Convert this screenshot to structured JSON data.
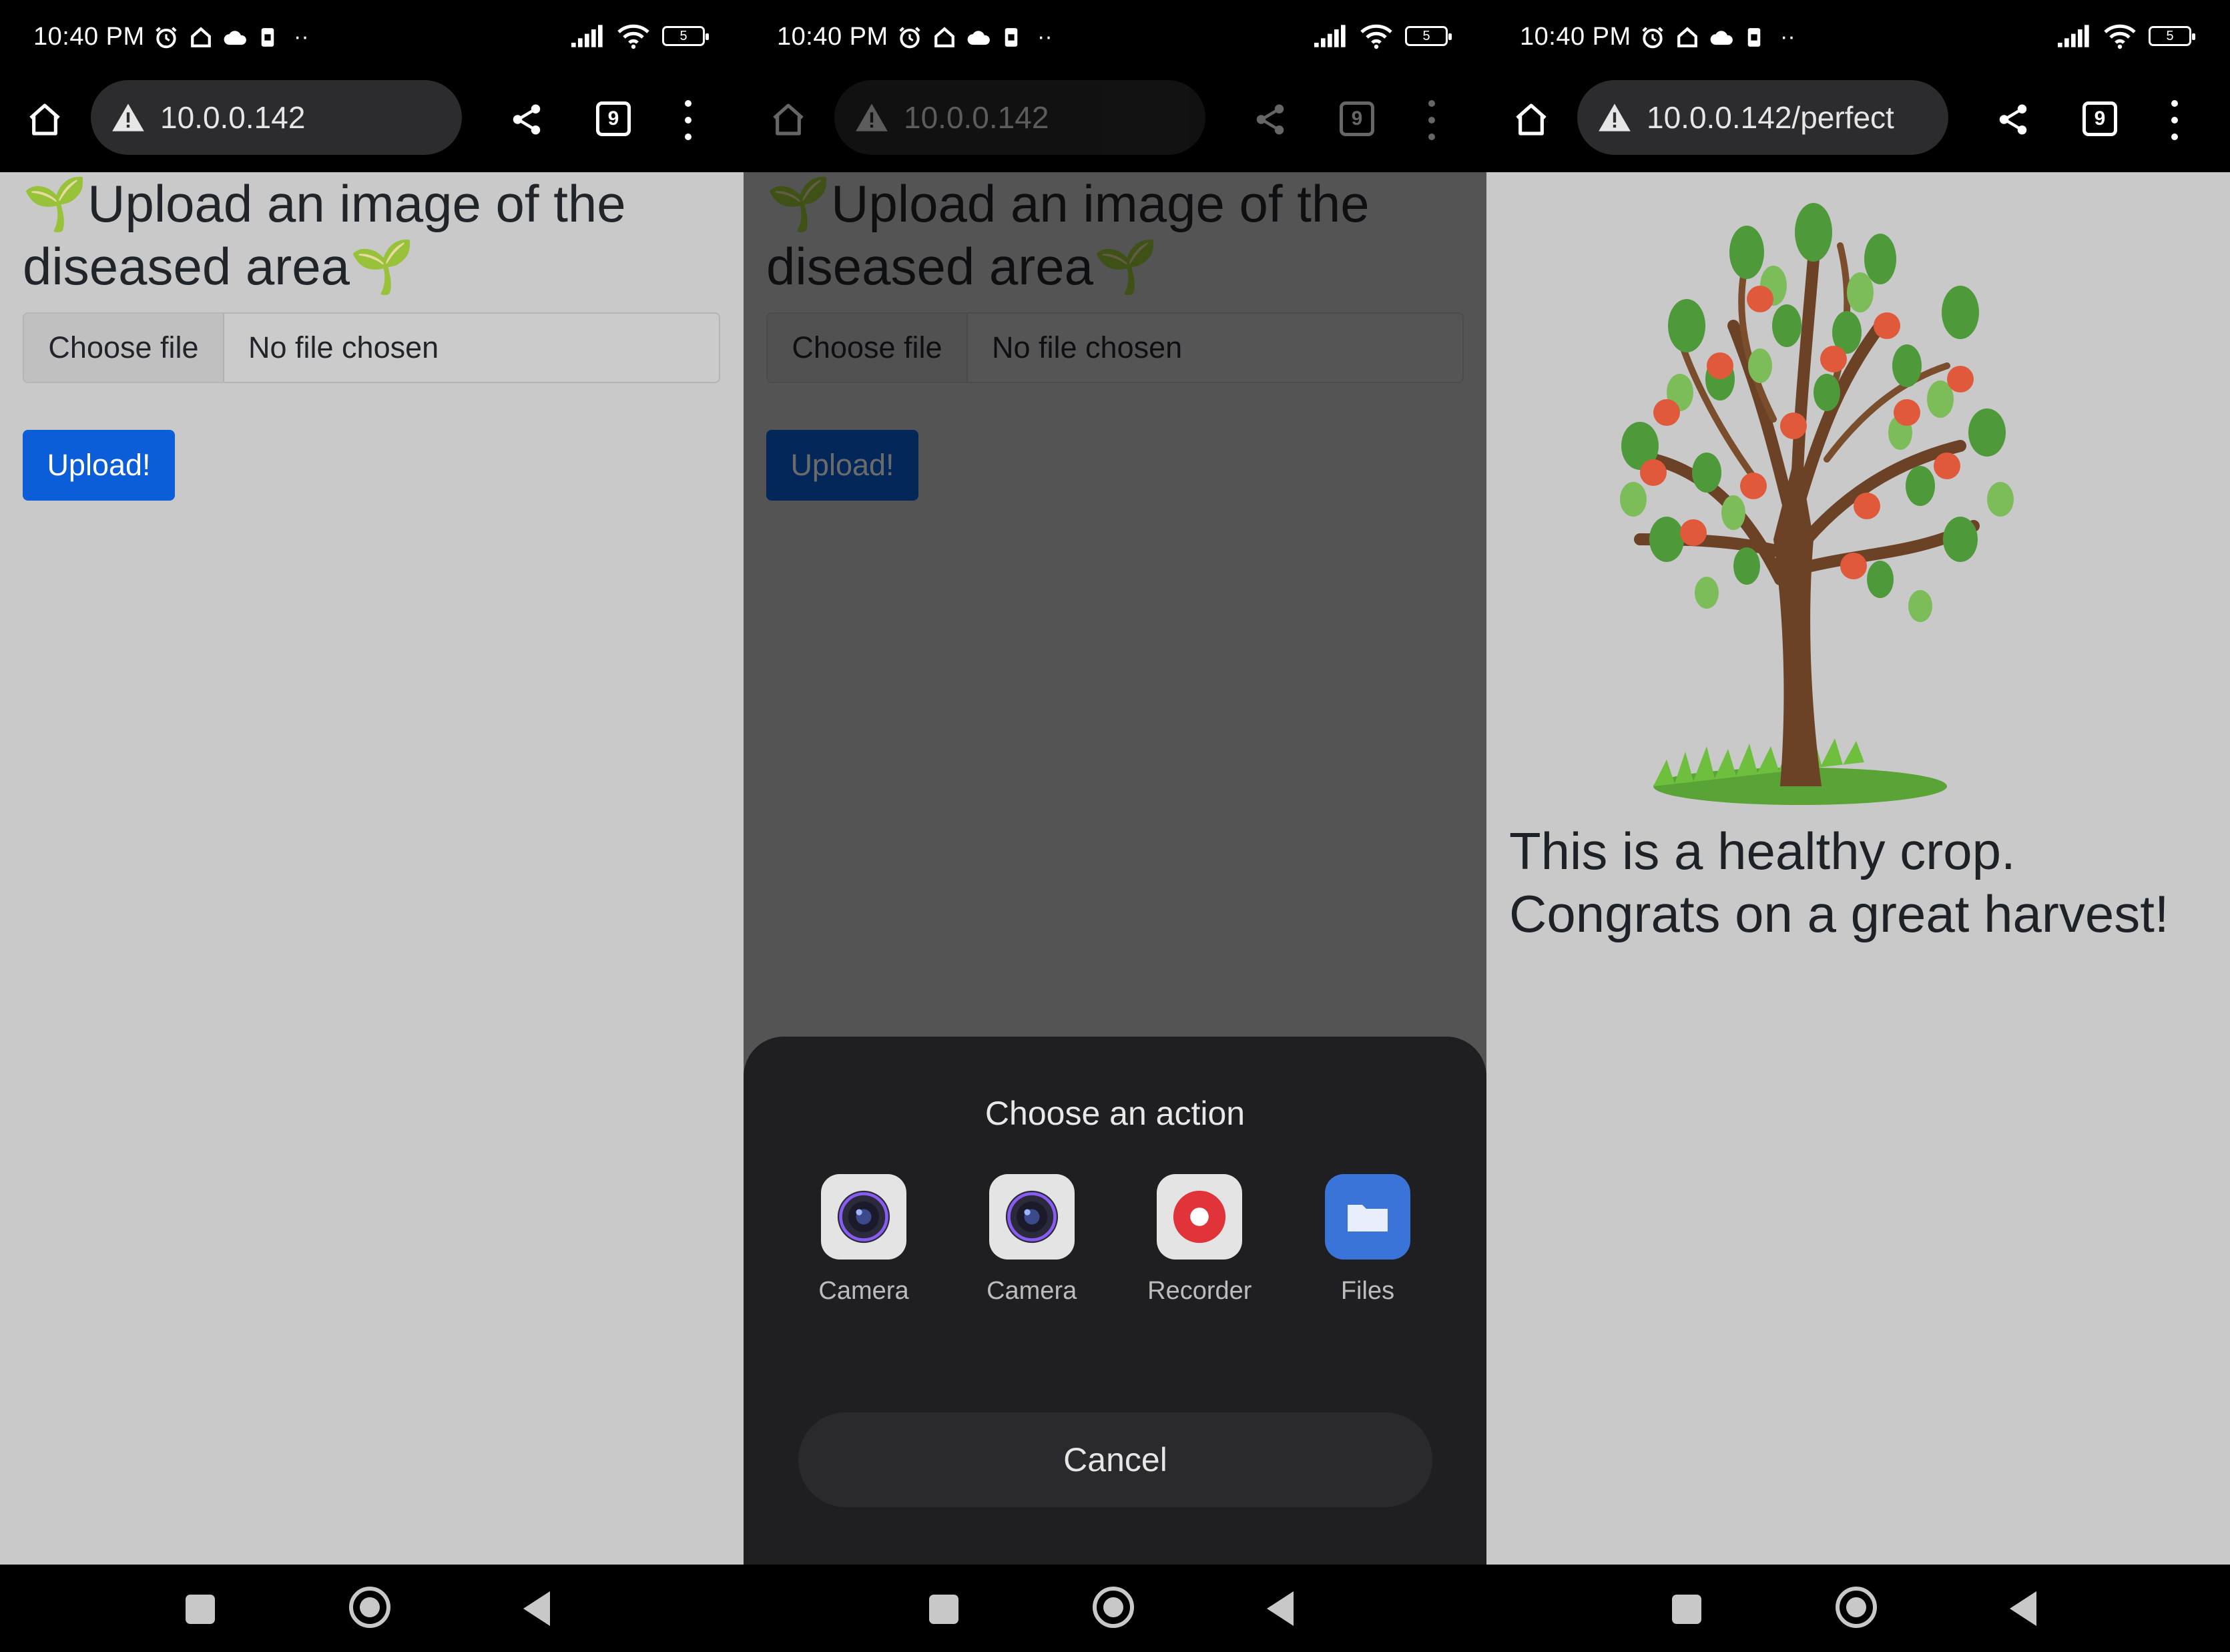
{
  "status_bar": {
    "time": "10:40 PM",
    "battery": "5"
  },
  "browser": {
    "tabs_count": "9",
    "panel1_url": "10.0.0.142",
    "panel2_url": "10.0.0.142",
    "panel3_url": "10.0.0.142/perfect"
  },
  "upload_page": {
    "heading_icon": "🌱",
    "heading_text": "Upload an image of the diseased area",
    "choose_file_label": "Choose file",
    "no_file_label": "No file chosen",
    "upload_label": "Upload!"
  },
  "action_sheet": {
    "title": "Choose an action",
    "actions": [
      {
        "label": "Camera",
        "icon": "camera-icon"
      },
      {
        "label": "Camera",
        "icon": "camera-icon"
      },
      {
        "label": "Recorder",
        "icon": "recorder-icon"
      },
      {
        "label": "Files",
        "icon": "folder-icon"
      }
    ],
    "cancel_label": "Cancel"
  },
  "result_page": {
    "message_line1": "This is a healthy crop.",
    "message_line2": "Congrats on a great harvest!"
  },
  "colors": {
    "primary_button": "#0b5ed7",
    "page_background": "#c9c9c9",
    "sheet_background": "#1f1f21"
  }
}
